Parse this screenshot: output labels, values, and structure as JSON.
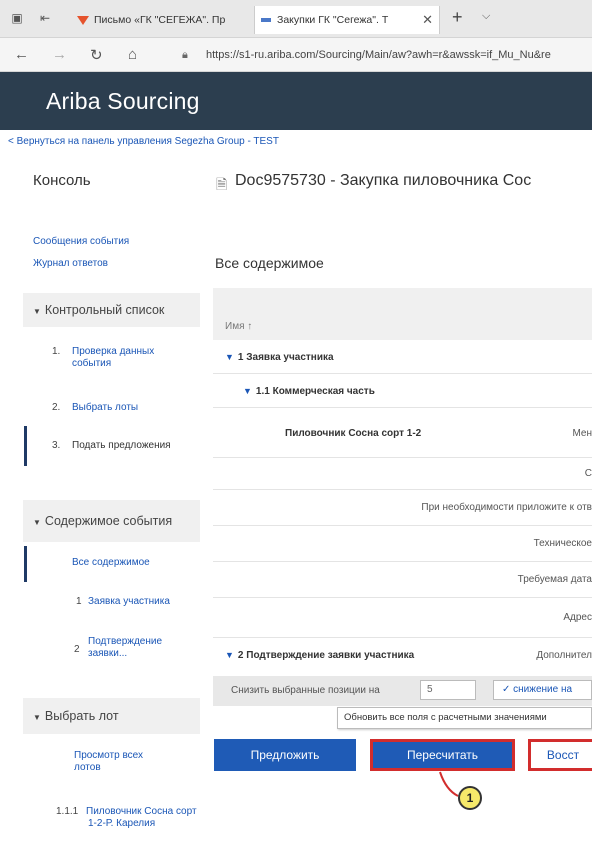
{
  "browser": {
    "tabs": [
      {
        "label": "Письмо «ГК \"СЕГЕЖА\". Пр"
      },
      {
        "label": "Закупки ГК \"Сегежа\". Т"
      }
    ],
    "url": "https://s1-ru.ariba.com/Sourcing/Main/aw?awh=r&awssk=if_Mu_Nu&re"
  },
  "app": {
    "title": "Ariba Sourcing",
    "back_link": "< Вернуться на панель управления Segezha Group - TEST"
  },
  "sidebar": {
    "console_title": "Консоль",
    "links": [
      "Сообщения события",
      "Журнал ответов"
    ],
    "checklist": {
      "title": "Контрольный список",
      "steps": [
        {
          "num": "1.",
          "label": "Проверка данных события"
        },
        {
          "num": "2.",
          "label": "Выбрать лоты"
        },
        {
          "num": "3.",
          "label": "Подать предложения"
        }
      ]
    },
    "event_contents": {
      "title": "Содержимое события",
      "items": [
        {
          "num": "",
          "label": "Все содержимое"
        },
        {
          "num": "1",
          "label": "Заявка участника"
        },
        {
          "num": "2",
          "label": "Подтверждение заявки..."
        }
      ]
    },
    "select_lot": {
      "title": "Выбрать лот",
      "items": [
        {
          "num": "",
          "label": "Просмотр всех лотов"
        },
        {
          "num": "1.1.1",
          "label": "Пиловочник Сосна сорт 1-2-Р. Карелия"
        }
      ]
    }
  },
  "main": {
    "doc_title": "Doc9575730 - Закупка пиловочника Сос",
    "content_title": "Все содержимое",
    "column_name": "Имя",
    "rows": {
      "r1": "1  Заявка участника",
      "r2": "1.1  Коммерческая часть",
      "r3_label": "Пиловочник Сосна сорт 1-2",
      "r3_right": "Мен",
      "r4_right": "С",
      "r5_right": "При необходимости приложите к отв",
      "r6_right": "Техническое",
      "r7_right": "Требуемая дата",
      "r8_right": "Адрес",
      "r9_label": "2  Подтверждение заявки участника",
      "r9_right": "Дополнител"
    },
    "calc": {
      "label": "Снизить выбранные позиции на",
      "value": "5",
      "select": "✓ снижение на",
      "tooltip": "Обновить все поля с расчетными значениями"
    },
    "buttons": {
      "submit": "Предложить",
      "recalc": "Пересчитать",
      "restore": "Восст"
    },
    "marker": "1"
  }
}
